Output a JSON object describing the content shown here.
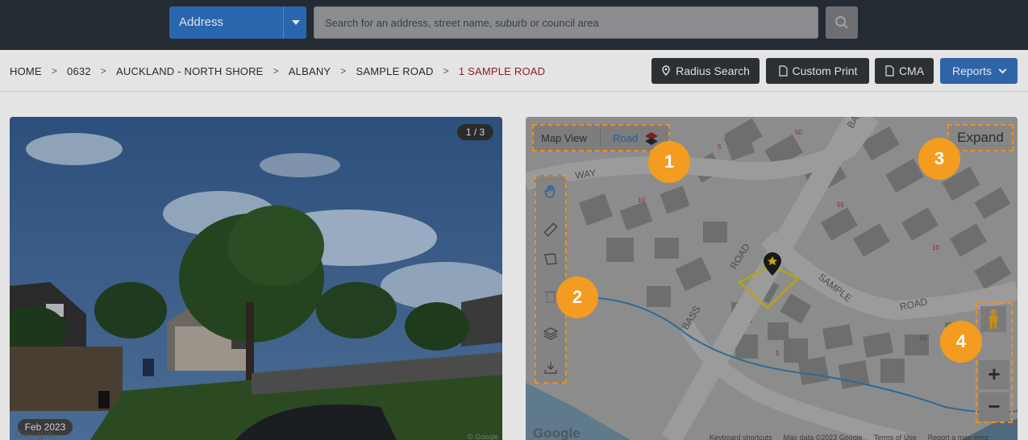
{
  "topbar": {
    "address_select": "Address",
    "search_placeholder": "Search for an address, street name, suburb or council area"
  },
  "breadcrumb": [
    "HOME",
    "0632",
    "AUCKLAND - NORTH SHORE",
    "ALBANY",
    "SAMPLE ROAD",
    "1 SAMPLE ROAD"
  ],
  "actions": {
    "radius_search": "Radius Search",
    "custom_print": "Custom Print",
    "cma": "CMA",
    "reports": "Reports"
  },
  "photo": {
    "counter": "1 / 3",
    "date": "Feb 2023",
    "attribution": "Google",
    "attribution_small": "© Google"
  },
  "map": {
    "map_view_label": "Map View",
    "road_label": "Road",
    "expand_label": "Expand",
    "street_labels": [
      "WAY",
      "ROAD",
      "BASS",
      "SAMPLE",
      "ROAD",
      "BA"
    ],
    "lot_numbers": [
      "50",
      "5",
      "10",
      "55",
      "10",
      "15",
      "5"
    ],
    "zoom_in": "+",
    "zoom_out": "−",
    "google": "Google",
    "footer": [
      "Keyboard shortcuts",
      "Map data ©2023 Google",
      "Terms of Use",
      "Report a map error"
    ],
    "tools": [
      "hand-icon",
      "ruler-icon",
      "polygon-icon",
      "trash-icon",
      "layers-icon",
      "download-icon"
    ]
  },
  "callouts": [
    "1",
    "2",
    "3",
    "4"
  ],
  "colors": {
    "accent_orange": "#f39c1f",
    "primary_blue": "#2f64a7",
    "topbar": "#252b33",
    "current_crumb": "#8a2020"
  }
}
